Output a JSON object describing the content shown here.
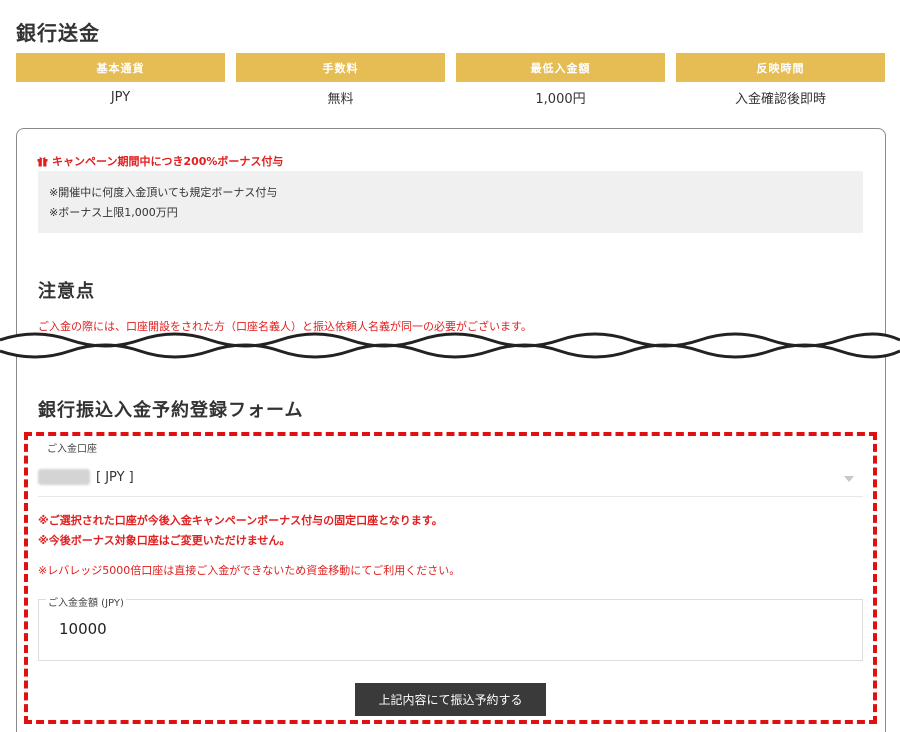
{
  "page": {
    "title": "銀行送金"
  },
  "info": [
    {
      "label": "基本通貨",
      "value": "JPY"
    },
    {
      "label": "手数料",
      "value": "無料"
    },
    {
      "label": "最低入金額",
      "value": "1,000円"
    },
    {
      "label": "反映時間",
      "value": "入金確認後即時"
    }
  ],
  "campaign": {
    "title": "キャンペーン期間中につき200%ボーナス付与",
    "notes": [
      "※開催中に何度入金頂いても規定ボーナス付与",
      "※ボーナス上限1,000万円"
    ]
  },
  "notice": {
    "title": "注意点",
    "line": "ご入金の際には、口座開設をされた方（口座名義人）と振込依頼人名義が同一の必要がございます。"
  },
  "form": {
    "title": "銀行振込入金予約登録フォーム",
    "account_label": "ご入金口座",
    "account_value": "[ JPY ]",
    "warnings": [
      "※ご選択された口座が今後入金キャンペーンボーナス付与の固定口座となります。",
      "※今後ボーナス対象口座はご変更いただけません。",
      "※レバレッジ5000倍口座は直接ご入金ができないため資金移動にてご利用ください。"
    ],
    "amount_label": "ご入金金額 (JPY)",
    "amount_value": "10000",
    "submit_label": "上記内容にて振込予約する"
  },
  "colors": {
    "header_gold": "#e6bd55",
    "alert_red": "#e02020",
    "frame_red": "#e01010",
    "button_dark": "#3a3a3a"
  }
}
